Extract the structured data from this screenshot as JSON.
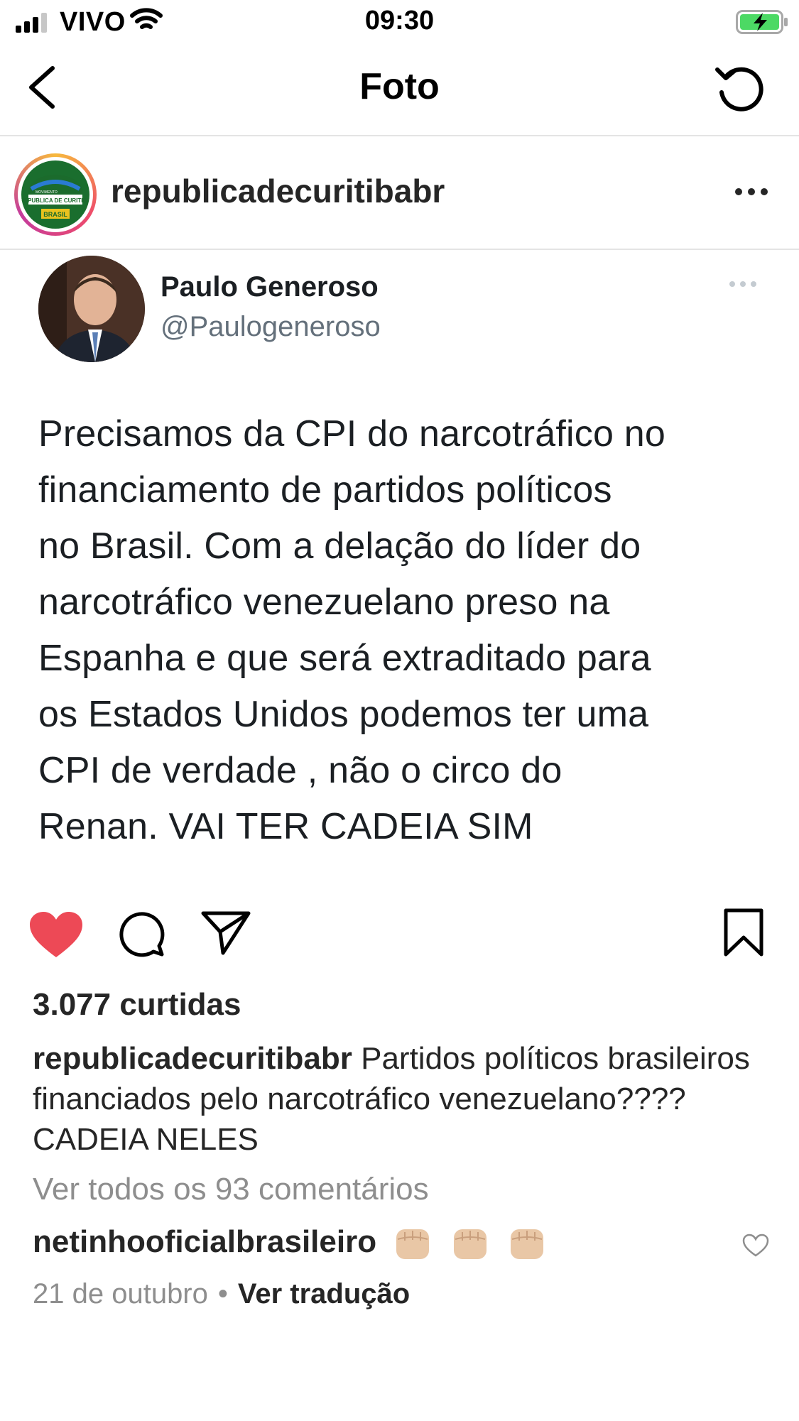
{
  "status_bar": {
    "carrier": "VIVO",
    "time": "09:30"
  },
  "nav": {
    "title": "Foto"
  },
  "post": {
    "username": "republicadecuritibabr",
    "avatar_text": {
      "top": "MOVIMENTO",
      "middle": "REPUBLICA DE CURITIBA",
      "bottom": "BRASIL"
    },
    "tweet": {
      "name": "Paulo Generoso",
      "handle": "@Paulogeneroso",
      "lines": [
        "Precisamos da CPI do narcotráfico no",
        "financiamento de partidos políticos",
        "no Brasil. Com a delação do líder do",
        "narcotráfico venezuelano preso na",
        "Espanha e que será extraditado para",
        "os Estados Unidos podemos ter uma",
        "CPI de verdade , não o circo do",
        "Renan. VAI TER CADEIA SIM"
      ]
    },
    "likes": "3.077 curtidas",
    "caption": {
      "user": "republicadecuritibabr",
      "text": " Partidos políticos brasileiros financiados pelo narcotráfico venezuelano???? CADEIA NELES"
    },
    "view_comments": "Ver todos os 93 comentários",
    "comment": {
      "user": "netinhooficialbrasileiro",
      "emoji_count": 3
    },
    "date": "21 de outubro",
    "separator": "•",
    "translate": "Ver tradução"
  },
  "colors": {
    "like_red": "#ed4956",
    "muted_gray": "#8e8e8e",
    "text_dark": "#262626",
    "logo_green": "#1a6e2e"
  },
  "icons": [
    "signal-icon",
    "wifi-icon",
    "battery-icon",
    "back-icon",
    "refresh-icon",
    "more-icon",
    "heart-icon",
    "comment-icon",
    "share-icon",
    "bookmark-icon",
    "small-heart-icon"
  ]
}
